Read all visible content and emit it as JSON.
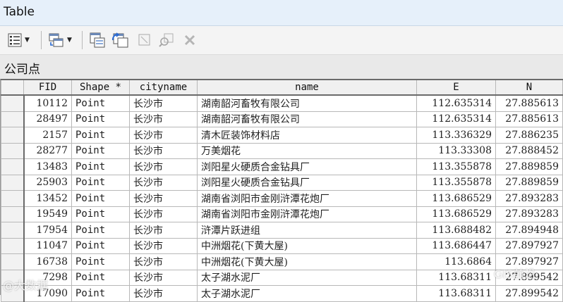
{
  "window": {
    "title": "Table"
  },
  "table_name": "公司点",
  "columns": [
    "FID",
    "Shape *",
    "cityname",
    "name",
    "E",
    "N"
  ],
  "rows": [
    {
      "fid": "10112",
      "shape": "Point",
      "city": "长沙市",
      "name": "湖南韶河畜牧有限公司",
      "e": "112.635314",
      "n": "27.885613"
    },
    {
      "fid": "28497",
      "shape": "Point",
      "city": "长沙市",
      "name": "湖南韶河畜牧有限公司",
      "e": "112.635314",
      "n": "27.885613"
    },
    {
      "fid": "2157",
      "shape": "Point",
      "city": "长沙市",
      "name": "清木匠装饰材料店",
      "e": "113.336329",
      "n": "27.886235"
    },
    {
      "fid": "28277",
      "shape": "Point",
      "city": "长沙市",
      "name": "万美烟花",
      "e": "113.33308",
      "n": "27.888452"
    },
    {
      "fid": "13483",
      "shape": "Point",
      "city": "长沙市",
      "name": "浏阳星火硬质合金钻具厂",
      "e": "113.355878",
      "n": "27.889859"
    },
    {
      "fid": "25903",
      "shape": "Point",
      "city": "长沙市",
      "name": "浏阳星火硬质合金钻具厂",
      "e": "113.355878",
      "n": "27.889859"
    },
    {
      "fid": "13452",
      "shape": "Point",
      "city": "长沙市",
      "name": "湖南省浏阳市金刚浒潭花炮厂",
      "e": "113.686529",
      "n": "27.893283"
    },
    {
      "fid": "19549",
      "shape": "Point",
      "city": "长沙市",
      "name": "湖南省浏阳市金刚浒潭花炮厂",
      "e": "113.686529",
      "n": "27.893283"
    },
    {
      "fid": "17954",
      "shape": "Point",
      "city": "长沙市",
      "name": "浒潭片跃进组",
      "e": "113.688482",
      "n": "27.894948"
    },
    {
      "fid": "11047",
      "shape": "Point",
      "city": "长沙市",
      "name": "中洲烟花(下黄大屋)",
      "e": "113.686447",
      "n": "27.897927"
    },
    {
      "fid": "16738",
      "shape": "Point",
      "city": "长沙市",
      "name": "中洲烟花(下黄大屋)",
      "e": "113.6864",
      "n": "27.897927"
    },
    {
      "fid": "7298",
      "shape": "Point",
      "city": "长沙市",
      "name": "太子湖水泥厂",
      "e": "113.68311",
      "n": "27.899542"
    },
    {
      "fid": "17090",
      "shape": "Point",
      "city": "长沙市",
      "name": "太子湖水泥厂",
      "e": "113.68311",
      "n": "27.899542"
    }
  ],
  "watermarks": {
    "left": "@大数据",
    "right": "GIS前沿"
  }
}
